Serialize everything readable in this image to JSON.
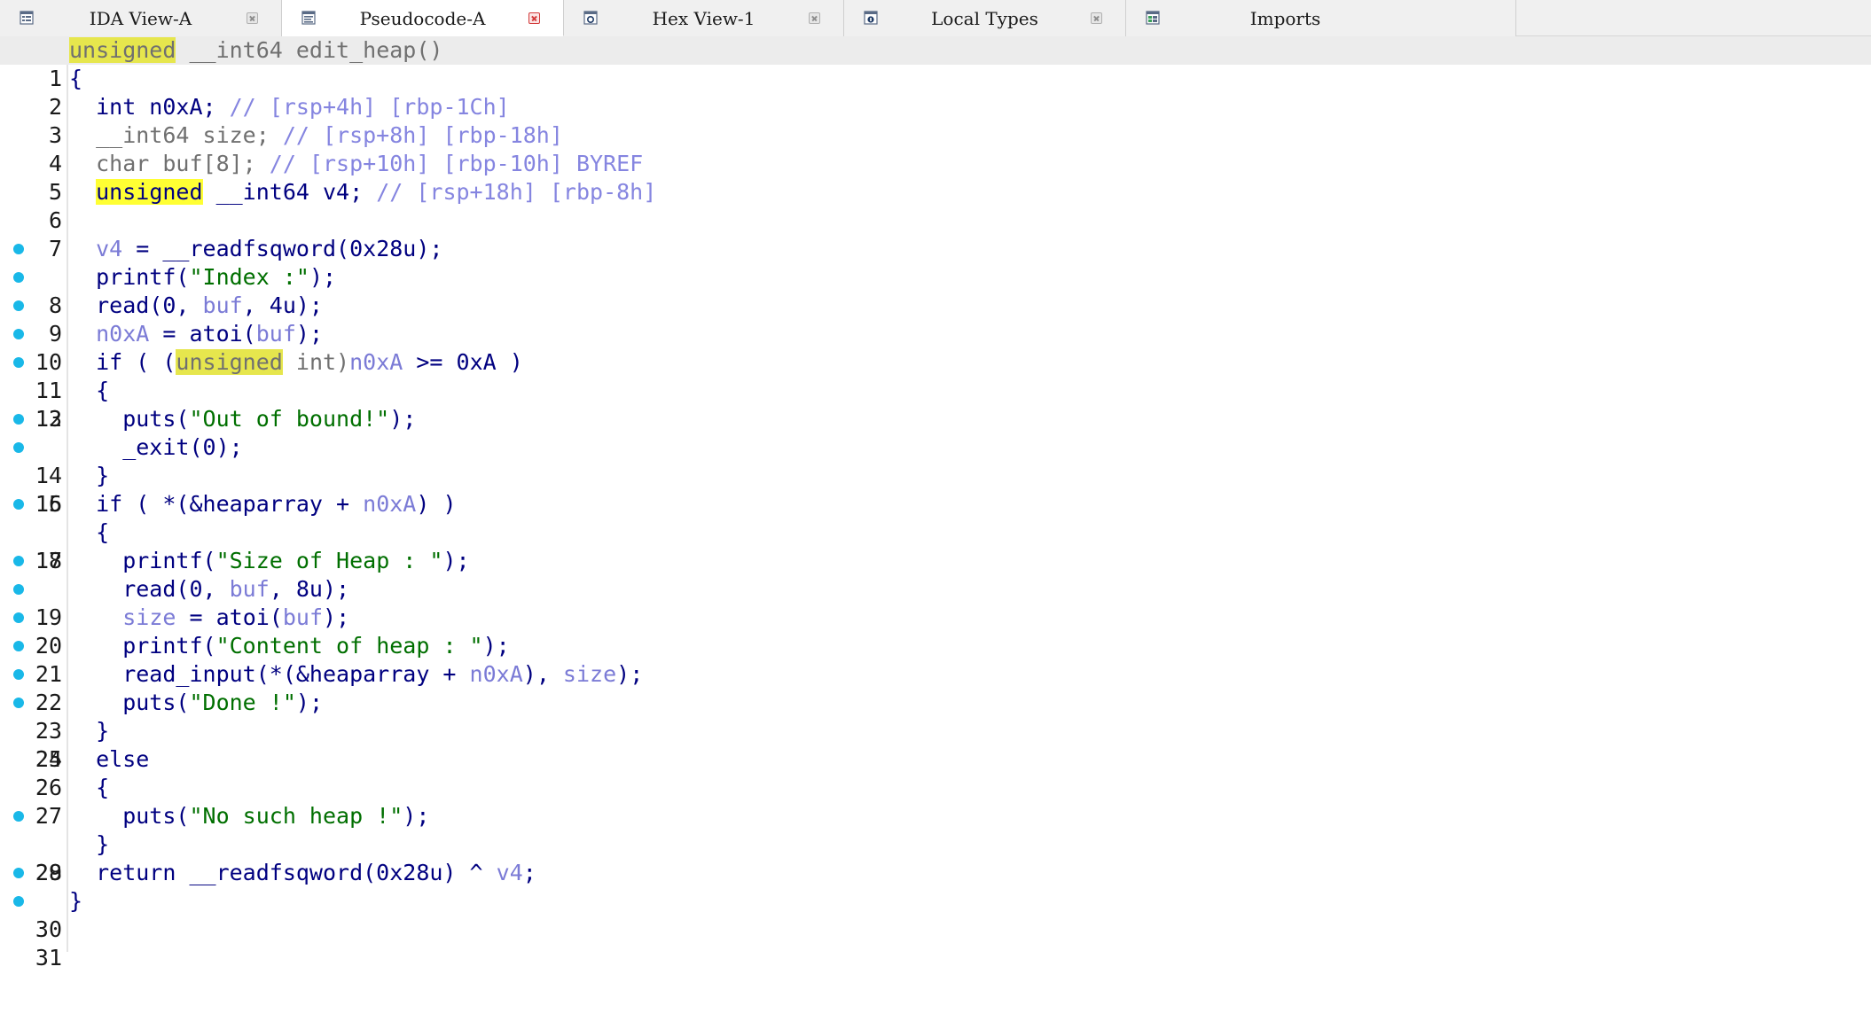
{
  "tabs": [
    {
      "label": "IDA View-A",
      "icon": "ida-view-icon",
      "active": false
    },
    {
      "label": "Pseudocode-A",
      "icon": "pseudocode-icon",
      "active": true
    },
    {
      "label": "Hex View-1",
      "icon": "hex-view-icon",
      "active": false
    },
    {
      "label": "Local Types",
      "icon": "local-types-icon",
      "active": false
    },
    {
      "label": "Imports",
      "icon": "imports-icon",
      "active": false
    }
  ],
  "colors": {
    "breakpoint": "#19b8e8",
    "keyword": "#000080",
    "variable": "#7b7bd6",
    "string": "#006f00",
    "comment": "#8585e0",
    "highlight": "#ffff33",
    "active_tab_close": "#d23a3a"
  },
  "code": {
    "line_numbers": [
      "1",
      "2",
      "3",
      "4",
      "5",
      "6",
      "7",
      "8",
      "9",
      "10",
      "11",
      "12",
      "13",
      "14",
      "15",
      "16",
      "17",
      "18",
      "19",
      "20",
      "21",
      "22",
      "23",
      "24",
      "25",
      "26",
      "27",
      "28",
      "29",
      "30",
      "31"
    ],
    "breakpoint_lines": [
      8,
      9,
      10,
      11,
      12,
      14,
      15,
      17,
      19,
      20,
      21,
      22,
      23,
      24,
      28,
      30,
      31
    ],
    "tokens": {
      "l1": [
        "unsigned",
        " __int64 edit_heap()"
      ],
      "l2": [
        "{"
      ],
      "l3": [
        "  int n0xA; ",
        "// [rsp+4h] [rbp-1Ch]"
      ],
      "l4": [
        "  __int64 size; ",
        "// [rsp+8h] [rbp-18h]"
      ],
      "l5": [
        "  char buf[8]; ",
        "// [rsp+10h] [rbp-10h] BYREF"
      ],
      "l6": [
        "  ",
        "unsigned",
        " __int64 v4; ",
        "// [rsp+18h] [rbp-8h]"
      ],
      "l8": [
        "  ",
        "v4",
        " = __readfsqword(0x28u);"
      ],
      "l9": [
        "  printf(",
        "\"Index :\"",
        ");"
      ],
      "l10": [
        "  read(0, ",
        "buf",
        ", 4u);"
      ],
      "l11": [
        "  ",
        "n0xA",
        " = atoi(",
        "buf",
        ");"
      ],
      "l12": [
        "  if ( (",
        "unsigned",
        " int)",
        "n0xA",
        " >= 0xA )"
      ],
      "l13": [
        "  {"
      ],
      "l14": [
        "    puts(",
        "\"Out of bound!\"",
        ");"
      ],
      "l15": [
        "    _exit(0);"
      ],
      "l16": [
        "  }"
      ],
      "l17": [
        "  if ( *(&heaparray + ",
        "n0xA",
        ") )"
      ],
      "l18": [
        "  {"
      ],
      "l19": [
        "    printf(",
        "\"Size of Heap : \"",
        ");"
      ],
      "l20": [
        "    read(0, ",
        "buf",
        ", 8u);"
      ],
      "l21": [
        "    ",
        "size",
        " = atoi(",
        "buf",
        ");"
      ],
      "l22": [
        "    printf(",
        "\"Content of heap : \"",
        ");"
      ],
      "l23": [
        "    read_input(*(&heaparray + ",
        "n0xA",
        "), ",
        "size",
        ");"
      ],
      "l24": [
        "    puts(",
        "\"Done !\"",
        ");"
      ],
      "l25": [
        "  }"
      ],
      "l26": [
        "  else"
      ],
      "l27": [
        "  {"
      ],
      "l28": [
        "    puts(",
        "\"No such heap !\"",
        ");"
      ],
      "l29": [
        "  }"
      ],
      "l30": [
        "  return __readfsqword(0x28u) ^ ",
        "v4",
        ";"
      ],
      "l31": [
        "}"
      ]
    }
  }
}
